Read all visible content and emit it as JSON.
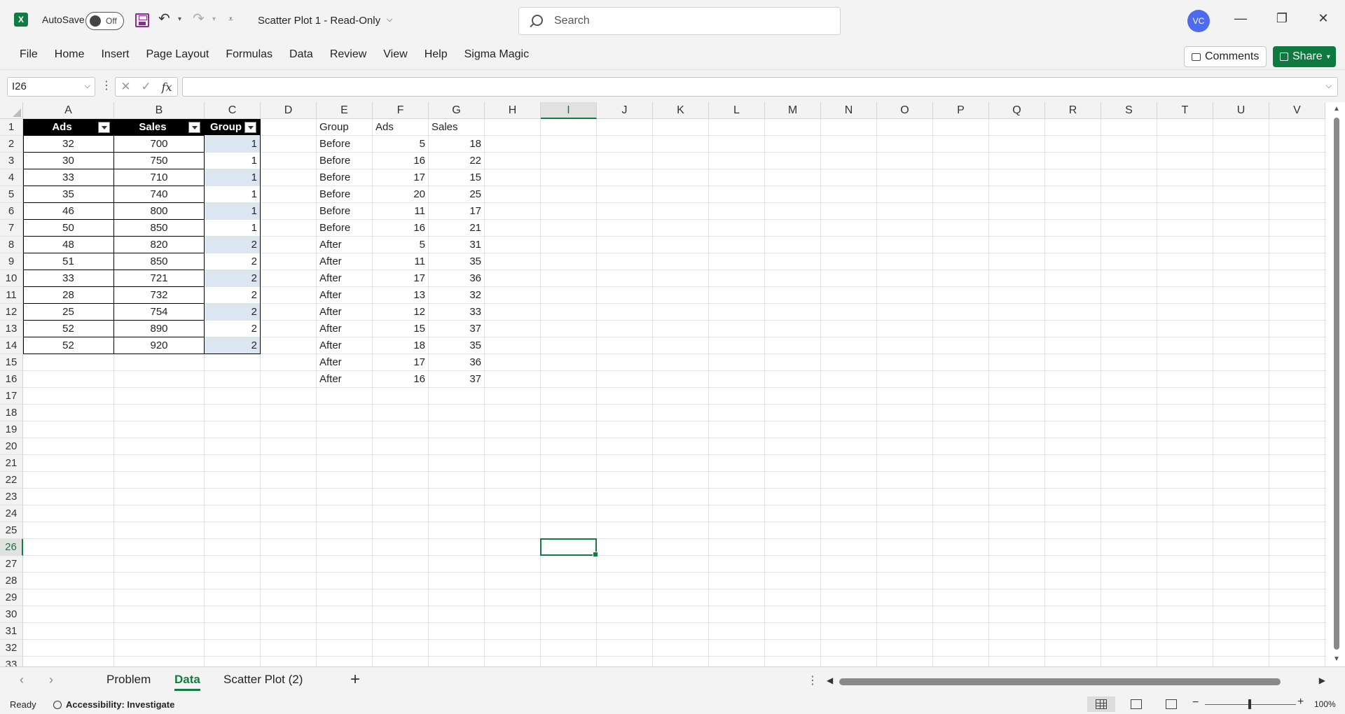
{
  "titlebar": {
    "app_logo": "X",
    "autosave_label": "AutoSave",
    "autosave_state": "Off",
    "doc_title": "Scatter Plot 1  -  Read-Only",
    "search_placeholder": "Search",
    "user_initials": "VC"
  },
  "ribbon": {
    "tabs": [
      "File",
      "Home",
      "Insert",
      "Page Layout",
      "Formulas",
      "Data",
      "Review",
      "View",
      "Help",
      "Sigma Magic"
    ],
    "comments_label": "Comments",
    "share_label": "Share"
  },
  "formula_bar": {
    "name_box": "I26",
    "formula": ""
  },
  "grid": {
    "columns": [
      "A",
      "B",
      "C",
      "D",
      "E",
      "F",
      "G",
      "H",
      "I",
      "J",
      "K",
      "L",
      "M",
      "N",
      "O",
      "P",
      "Q",
      "R",
      "S",
      "T",
      "U",
      "V"
    ],
    "rows": [
      "1",
      "2",
      "3",
      "4",
      "5",
      "6",
      "7",
      "8",
      "9",
      "10",
      "11",
      "12",
      "13",
      "14",
      "15",
      "16",
      "17",
      "18",
      "19",
      "20",
      "21",
      "22",
      "23",
      "24",
      "25",
      "26",
      "27",
      "28",
      "29",
      "30",
      "31",
      "32",
      "33"
    ],
    "selected_cell": "I26",
    "table1": {
      "headers": [
        "Ads",
        "Sales",
        "Group"
      ],
      "rows": [
        [
          "32",
          "700",
          "1"
        ],
        [
          "30",
          "750",
          "1"
        ],
        [
          "33",
          "710",
          "1"
        ],
        [
          "35",
          "740",
          "1"
        ],
        [
          "46",
          "800",
          "1"
        ],
        [
          "50",
          "850",
          "1"
        ],
        [
          "48",
          "820",
          "2"
        ],
        [
          "51",
          "850",
          "2"
        ],
        [
          "33",
          "721",
          "2"
        ],
        [
          "28",
          "732",
          "2"
        ],
        [
          "25",
          "754",
          "2"
        ],
        [
          "52",
          "890",
          "2"
        ],
        [
          "52",
          "920",
          "2"
        ]
      ]
    },
    "table2": {
      "headers": [
        "Group",
        "Ads",
        "Sales"
      ],
      "rows": [
        [
          "Before",
          "5",
          "18"
        ],
        [
          "Before",
          "16",
          "22"
        ],
        [
          "Before",
          "17",
          "15"
        ],
        [
          "Before",
          "20",
          "25"
        ],
        [
          "Before",
          "11",
          "17"
        ],
        [
          "Before",
          "16",
          "21"
        ],
        [
          "After",
          "5",
          "31"
        ],
        [
          "After",
          "11",
          "35"
        ],
        [
          "After",
          "17",
          "36"
        ],
        [
          "After",
          "13",
          "32"
        ],
        [
          "After",
          "12",
          "33"
        ],
        [
          "After",
          "15",
          "37"
        ],
        [
          "After",
          "18",
          "35"
        ],
        [
          "After",
          "17",
          "36"
        ],
        [
          "After",
          "16",
          "37"
        ]
      ]
    }
  },
  "sheets": {
    "tabs": [
      "Problem",
      "Data",
      "Scatter Plot (2)"
    ],
    "active": "Data"
  },
  "status": {
    "ready": "Ready",
    "accessibility": "Accessibility: Investigate",
    "zoom": "100%"
  },
  "colors": {
    "accent": "#107c41",
    "band": "#dce6f1",
    "avatar": "#4f6bed"
  }
}
